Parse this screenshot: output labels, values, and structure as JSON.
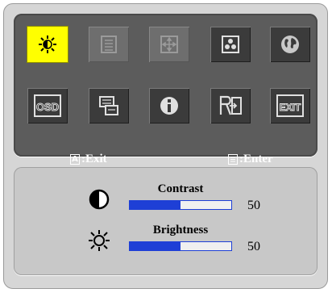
{
  "colors": {
    "active_icon": "#ffff00",
    "bar_fill": "#1e3fd6"
  },
  "menu_icons": [
    {
      "name": "brightness-icon",
      "state": "selected"
    },
    {
      "name": "document-icon",
      "state": "disabled"
    },
    {
      "name": "position-icon",
      "state": "disabled"
    },
    {
      "name": "color-icon",
      "state": "normal"
    },
    {
      "name": "globe-icon",
      "state": "normal"
    },
    {
      "name": "osd-icon",
      "state": "normal"
    },
    {
      "name": "input-source-icon",
      "state": "normal"
    },
    {
      "name": "info-icon",
      "state": "normal"
    },
    {
      "name": "reset-icon",
      "state": "normal"
    },
    {
      "name": "exit-icon",
      "state": "normal"
    }
  ],
  "icon_text": {
    "osd": "OSD",
    "exit": "EXIT"
  },
  "keys": {
    "exit_glyph": "A",
    "exit_label": ":Exit",
    "enter_label": ":Enter"
  },
  "adjustments": {
    "contrast": {
      "label": "Contrast",
      "value": "50",
      "level": 0.5
    },
    "brightness": {
      "label": "Brightness",
      "value": "50",
      "level": 0.5
    }
  }
}
